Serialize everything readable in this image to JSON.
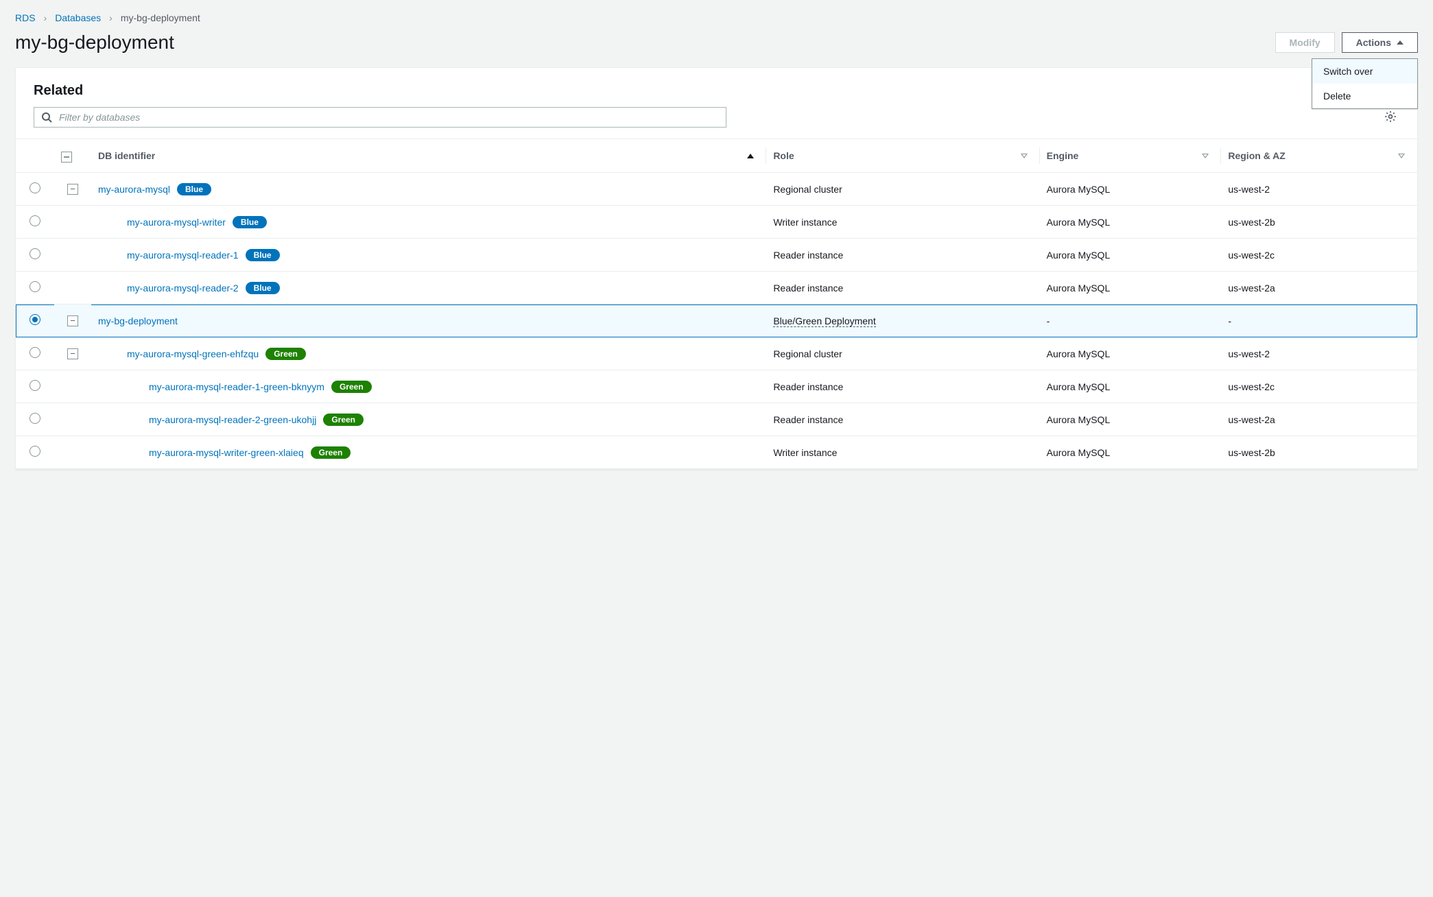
{
  "breadcrumb": {
    "root": "RDS",
    "parent": "Databases",
    "current": "my-bg-deployment"
  },
  "title": "my-bg-deployment",
  "buttons": {
    "modify": "Modify",
    "actions": "Actions"
  },
  "actions_menu": {
    "switch_over": "Switch over",
    "delete": "Delete"
  },
  "panel": {
    "title": "Related",
    "filter_placeholder": "Filter by databases"
  },
  "columns": {
    "identifier": "DB identifier",
    "role": "Role",
    "engine": "Engine",
    "region": "Region & AZ"
  },
  "rows": [
    {
      "id": "my-aurora-mysql",
      "badge": "Blue",
      "badge_class": "blue",
      "role": "Regional cluster",
      "engine": "Aurora MySQL",
      "region": "us-west-2",
      "depth": 0,
      "expandable": true,
      "selected": false
    },
    {
      "id": "my-aurora-mysql-writer",
      "badge": "Blue",
      "badge_class": "blue",
      "role": "Writer instance",
      "engine": "Aurora MySQL",
      "region": "us-west-2b",
      "depth": 1,
      "expandable": false,
      "selected": false
    },
    {
      "id": "my-aurora-mysql-reader-1",
      "badge": "Blue",
      "badge_class": "blue",
      "role": "Reader instance",
      "engine": "Aurora MySQL",
      "region": "us-west-2c",
      "depth": 1,
      "expandable": false,
      "selected": false
    },
    {
      "id": "my-aurora-mysql-reader-2",
      "badge": "Blue",
      "badge_class": "blue",
      "role": "Reader instance",
      "engine": "Aurora MySQL",
      "region": "us-west-2a",
      "depth": 1,
      "expandable": false,
      "selected": false
    },
    {
      "id": "my-bg-deployment",
      "badge": "",
      "badge_class": "",
      "role": "Blue/Green Deployment",
      "role_underline": true,
      "engine": "-",
      "region": "-",
      "depth": 0,
      "expandable": true,
      "selected": true
    },
    {
      "id": "my-aurora-mysql-green-ehfzqu",
      "badge": "Green",
      "badge_class": "green",
      "role": "Regional cluster",
      "engine": "Aurora MySQL",
      "region": "us-west-2",
      "depth": 1,
      "expandable": true,
      "selected": false
    },
    {
      "id": "my-aurora-mysql-reader-1-green-bknyym",
      "badge": "Green",
      "badge_class": "green",
      "role": "Reader instance",
      "engine": "Aurora MySQL",
      "region": "us-west-2c",
      "depth": 2,
      "expandable": false,
      "selected": false
    },
    {
      "id": "my-aurora-mysql-reader-2-green-ukohjj",
      "badge": "Green",
      "badge_class": "green",
      "role": "Reader instance",
      "engine": "Aurora MySQL",
      "region": "us-west-2a",
      "depth": 2,
      "expandable": false,
      "selected": false
    },
    {
      "id": "my-aurora-mysql-writer-green-xlaieq",
      "badge": "Green",
      "badge_class": "green",
      "role": "Writer instance",
      "engine": "Aurora MySQL",
      "region": "us-west-2b",
      "depth": 2,
      "expandable": false,
      "selected": false
    }
  ]
}
